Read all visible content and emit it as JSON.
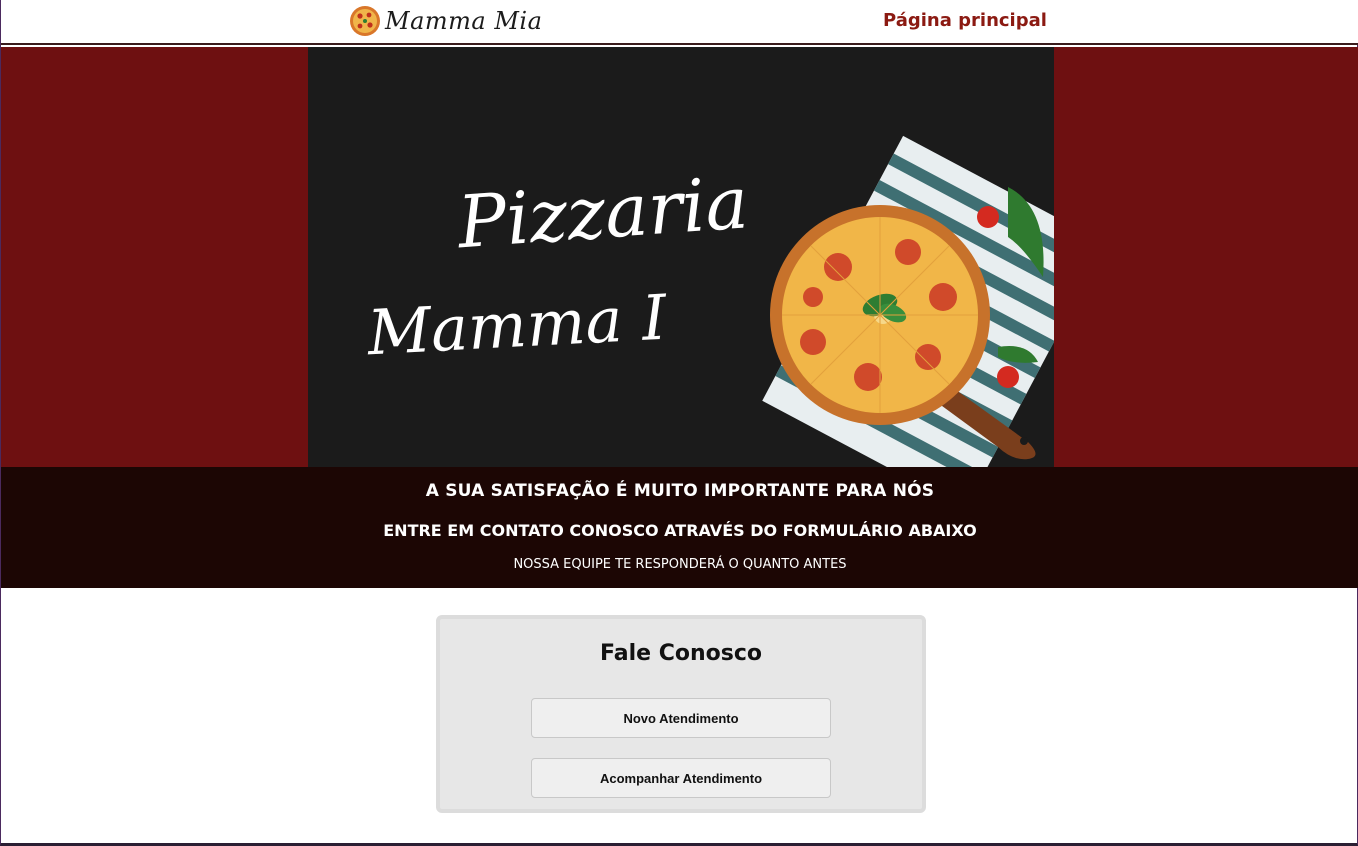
{
  "header": {
    "logo_text": "Mamma Mia",
    "nav_link": "Página principal"
  },
  "hero": {
    "banner_title": "Pizzaria",
    "banner_subtitle": "Mamma I"
  },
  "band": {
    "line1": "A SUA SATISFAÇÃO É MUITO IMPORTANTE PARA NÓS",
    "line2": "ENTRE EM CONTATO CONOSCO ATRAVÉS DO FORMULÁRIO ABAIXO",
    "line3": "NOSSA EQUIPE TE RESPONDERÁ O QUANTO ANTES"
  },
  "contact": {
    "title": "Fale Conosco",
    "buttons": [
      "Novo Atendimento",
      "Acompanhar Atendimento"
    ]
  },
  "colors": {
    "brand_red": "#6e1011",
    "link_red": "#8b1a12",
    "band_dark": "#1c0604",
    "banner_black": "#1a1a1a"
  }
}
